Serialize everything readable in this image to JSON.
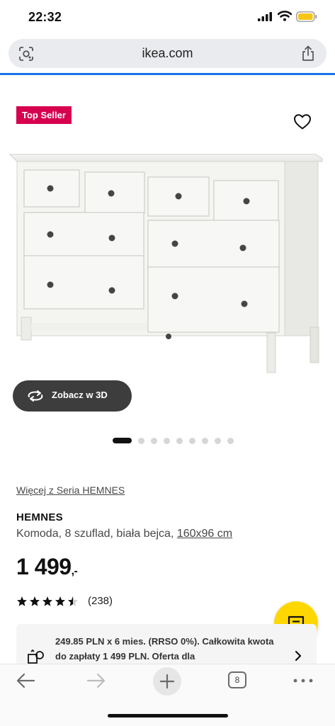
{
  "status": {
    "time": "22:32"
  },
  "browser": {
    "url": "ikea.com",
    "open_tabs": "8"
  },
  "product": {
    "badge": "Top Seller",
    "view_3d_label": "Zobacz w 3D",
    "image_count": 9,
    "active_image": 1,
    "series_link": "Więcej z Seria HEMNES",
    "name": "HEMNES",
    "description": "Komoda, 8 szuflad, biała bejca, ",
    "dimensions": "160x96 cm",
    "price_main": "1 499",
    "price_suffix": ",-",
    "rating_stars": 4.5,
    "rating_count": "(238)",
    "financing_text": "249.85 PLN x 6 mies. (RRSO 0%). Całkowita kwota do zapłaty 1 499 PLN. Oferta dla"
  },
  "colors": {
    "badge": "#d6004f",
    "chat_button": "#ffd700",
    "progress": "#1a73e8",
    "view_3d_button": "#3d3d3d"
  },
  "icons": {
    "lens": "lens-icon",
    "share": "share-icon",
    "favorite": "heart-icon",
    "rotate": "rotate-3d-icon",
    "chat": "chat-icon",
    "financing": "installment-icon",
    "back": "back-arrow-icon",
    "forward": "forward-arrow-icon",
    "new_tab": "plus-icon",
    "menu": "more-icon"
  }
}
